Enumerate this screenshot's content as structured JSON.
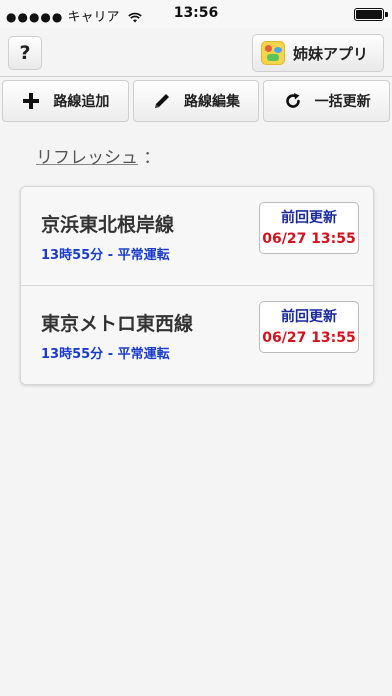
{
  "status_bar": {
    "carrier": "キャリア",
    "time": "13:56"
  },
  "nav": {
    "help_label": "?",
    "sister_app_label": "姉妹アプリ"
  },
  "toolbar": {
    "add_label": "路線追加",
    "edit_label": "路線編集",
    "refresh_all_label": "一括更新"
  },
  "refresh": {
    "label": "リフレッシュ",
    "suffix": "："
  },
  "lines": [
    {
      "name": "京浜東北根岸線",
      "status": "13時55分 - 平常運転",
      "update_title": "前回更新",
      "update_time": "06/27 13:55"
    },
    {
      "name": "東京メトロ東西線",
      "status": "13時55分 - 平常運転",
      "update_title": "前回更新",
      "update_time": "06/27 13:55"
    }
  ],
  "colors": {
    "status_blue": "#1a3ccc",
    "update_red": "#d2121d",
    "update_title_blue": "#1a2a9c"
  },
  "icons": {
    "add": "plus-icon",
    "edit": "pencil-icon",
    "refresh": "refresh-icon"
  }
}
